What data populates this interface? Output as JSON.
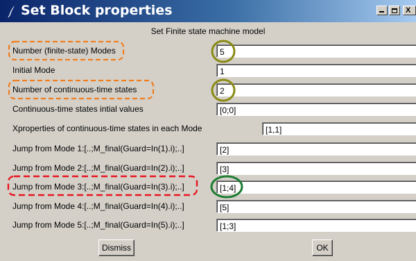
{
  "window": {
    "title": "Set Block properties",
    "subtitle": "Set Finite state machine model",
    "minimize_glyph": "_",
    "close_glyph": "X"
  },
  "fields": [
    {
      "label": "Number (finite-state) Modes",
      "value": "5"
    },
    {
      "label": "Initial Mode",
      "value": "1"
    },
    {
      "label": "Number of continuous-time states",
      "value": "2"
    },
    {
      "label": "Continuous-time states intial values",
      "value": "[0;0]"
    },
    {
      "label": "Xproperties of continuous-time states in each Mode",
      "value": "[1,1]"
    },
    {
      "label": "Jump from Mode 1:[..;M_final(Guard=In(1).i);..]",
      "value": "[2]"
    },
    {
      "label": "Jump from Mode 2:[..;M_final(Guard=In(2).i);..]",
      "value": "[3]"
    },
    {
      "label": "Jump from Mode 3:[..;M_final(Guard=In(3).i);..]",
      "value": "[1;4]"
    },
    {
      "label": "Jump from Mode 4:[..;M_final(Guard=In(4).i);..]",
      "value": "[5]"
    },
    {
      "label": "Jump from Mode 5:[..;M_final(Guard=In(5).i);..]",
      "value": "[1;3]"
    }
  ],
  "buttons": {
    "dismiss": "Dismiss",
    "ok": "OK"
  },
  "annotations": {
    "orange_dashed_highlight_color": "#f07d1e",
    "red_dashed_highlight_color": "#e8141e",
    "olive_circle_color": "#8a8a14",
    "green_circle_color": "#1e7d32"
  },
  "icons": {
    "app_icon": "feather-quill-icon",
    "minimize": "minimize-icon",
    "maximize": "maximize-icon",
    "close": "close-icon"
  }
}
